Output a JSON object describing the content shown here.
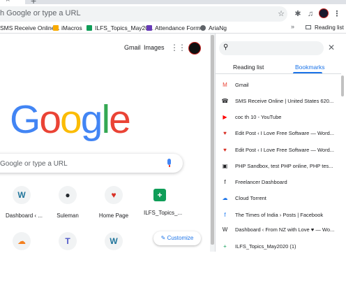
{
  "omnibox": {
    "text": "h Google or type a URL"
  },
  "bookmarks_bar": [
    {
      "label": "SMS Receive Online...",
      "color": "#5f6368"
    },
    {
      "label": "iMacros",
      "color": "#f9ab00"
    },
    {
      "label": "ILFS_Topics_May20...",
      "color": "#0f9d58"
    },
    {
      "label": "Attendance Form",
      "color": "#673ab7"
    },
    {
      "label": "AriaNg",
      "color": "#5f6368"
    }
  ],
  "reading_list_button": "Reading list",
  "ntp": {
    "gmail": "Gmail",
    "images": "Images",
    "logo": [
      "G",
      "o",
      "o",
      "g",
      "l",
      "e"
    ],
    "search_placeholder": "Google or type a URL",
    "tiles": [
      {
        "label": "Dashboard ‹ ...",
        "glyph": "W"
      },
      {
        "label": "Suleman",
        "glyph": "●"
      },
      {
        "label": "Home Page",
        "glyph": "♥"
      },
      {
        "label": "ILFS_Topics_...",
        "glyph": "+"
      },
      {
        "label": "",
        "glyph": "☁"
      },
      {
        "label": "",
        "glyph": "T"
      },
      {
        "label": "",
        "glyph": "W"
      }
    ],
    "customize": "Customize"
  },
  "panel": {
    "tabs": [
      "Reading list",
      "Bookmarks"
    ],
    "active_tab": "Bookmarks",
    "items": [
      {
        "label": "Gmail",
        "icon": "M",
        "color": "#ea4335"
      },
      {
        "label": "SMS Receive Online | United States 620...",
        "icon": "☎",
        "color": "#202124"
      },
      {
        "label": "coc th 10 - YouTube",
        "icon": "▶",
        "color": "#ff0000"
      },
      {
        "label": "Edit Post ‹ I Love Free Software — Word...",
        "icon": "♥",
        "color": "#d93025"
      },
      {
        "label": "Edit Post ‹ I Love Free Software — Word...",
        "icon": "♥",
        "color": "#d93025"
      },
      {
        "label": "PHP Sandbox, test PHP online, PHP tes...",
        "icon": "▣",
        "color": "#202124"
      },
      {
        "label": "Freelancer Dashboard",
        "icon": "f",
        "color": "#202124"
      },
      {
        "label": "Cloud Torrent",
        "icon": "☁",
        "color": "#1a73e8"
      },
      {
        "label": "The Times of India › Posts | Facebook",
        "icon": "f",
        "color": "#1877f2"
      },
      {
        "label": "Dashboard ‹ From NZ with Love ♥ — Wo...",
        "icon": "W",
        "color": "#202124"
      },
      {
        "label": "ILFS_Topics_May2020 (1)",
        "icon": "+",
        "color": "#0f9d58"
      }
    ]
  }
}
